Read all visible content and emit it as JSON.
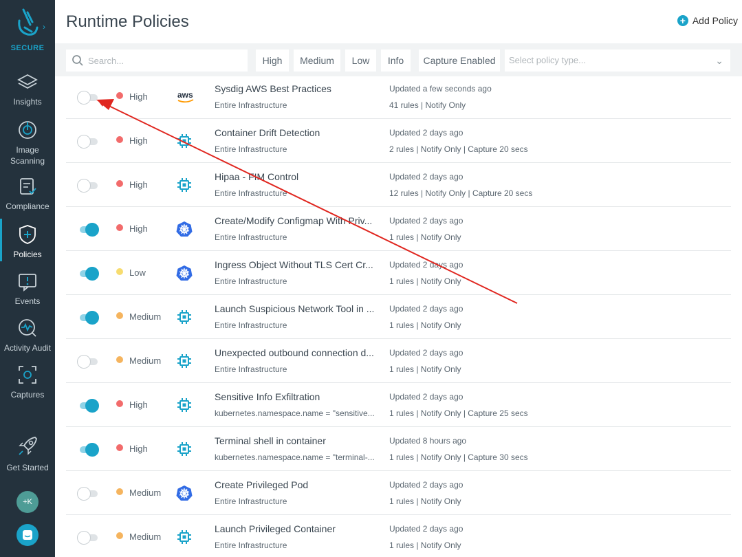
{
  "sidebar": {
    "brand": "SECURE",
    "items": [
      {
        "label": "Insights",
        "icon": "layers-icon"
      },
      {
        "label": "Image Scanning",
        "icon": "scan-icon"
      },
      {
        "label": "Compliance",
        "icon": "clipboard-check-icon"
      },
      {
        "label": "Policies",
        "icon": "shield-plus-icon",
        "active": true
      },
      {
        "label": "Events",
        "icon": "alert-monitor-icon"
      },
      {
        "label": "Activity Audit",
        "icon": "pulse-icon"
      },
      {
        "label": "Captures",
        "icon": "capture-icon"
      }
    ],
    "get_started": "Get Started",
    "avatar": "+K"
  },
  "header": {
    "title": "Runtime Policies",
    "add_policy": "Add Policy"
  },
  "filters": {
    "search_placeholder": "Search...",
    "chips": [
      "High",
      "Medium",
      "Low",
      "Info",
      "Capture Enabled"
    ],
    "type_placeholder": "Select policy type..."
  },
  "colors": {
    "accent": "#1aa3c9",
    "high": "#f26b6b",
    "medium": "#f5b45e",
    "low": "#f7dc6f",
    "sidebar": "#24323d"
  },
  "policies": [
    {
      "enabled": false,
      "severity": "High",
      "source": "aws",
      "name": "Sysdig AWS Best Practices",
      "scope": "Entire Infrastructure",
      "updated": "Updated a few seconds ago",
      "meta": "41 rules | Notify Only"
    },
    {
      "enabled": false,
      "severity": "High",
      "source": "falco",
      "name": "Container Drift Detection",
      "scope": "Entire Infrastructure",
      "updated": "Updated 2 days ago",
      "meta": "2 rules | Notify Only | Capture 20 secs"
    },
    {
      "enabled": false,
      "severity": "High",
      "source": "falco",
      "name": "Hipaa - FIM Control",
      "scope": "Entire Infrastructure",
      "updated": "Updated 2 days ago",
      "meta": "12 rules | Notify Only | Capture 20 secs"
    },
    {
      "enabled": true,
      "severity": "High",
      "source": "k8s",
      "name": "Create/Modify Configmap With Priv...",
      "scope": "Entire Infrastructure",
      "updated": "Updated 2 days ago",
      "meta": "1 rules | Notify Only"
    },
    {
      "enabled": true,
      "severity": "Low",
      "source": "k8s",
      "name": "Ingress Object Without TLS Cert Cr...",
      "scope": "Entire Infrastructure",
      "updated": "Updated 2 days ago",
      "meta": "1 rules | Notify Only"
    },
    {
      "enabled": true,
      "severity": "Medium",
      "source": "falco",
      "name": "Launch Suspicious Network Tool in ...",
      "scope": "Entire Infrastructure",
      "updated": "Updated 2 days ago",
      "meta": "1 rules | Notify Only"
    },
    {
      "enabled": false,
      "severity": "Medium",
      "source": "falco",
      "name": "Unexpected outbound connection d...",
      "scope": "Entire Infrastructure",
      "updated": "Updated 2 days ago",
      "meta": "1 rules | Notify Only"
    },
    {
      "enabled": true,
      "severity": "High",
      "source": "falco",
      "name": "Sensitive Info Exfiltration",
      "scope": "kubernetes.namespace.name = \"sensitive...",
      "updated": "Updated 2 days ago",
      "meta": "1 rules | Notify Only | Capture 25 secs"
    },
    {
      "enabled": true,
      "severity": "High",
      "source": "falco",
      "name": "Terminal shell in container",
      "scope": "kubernetes.namespace.name = \"terminal-...",
      "updated": "Updated 8 hours ago",
      "meta": "1 rules | Notify Only | Capture 30 secs"
    },
    {
      "enabled": false,
      "severity": "Medium",
      "source": "k8s",
      "name": "Create Privileged Pod",
      "scope": "Entire Infrastructure",
      "updated": "Updated 2 days ago",
      "meta": "1 rules | Notify Only"
    },
    {
      "enabled": false,
      "severity": "Medium",
      "source": "falco",
      "name": "Launch Privileged Container",
      "scope": "Entire Infrastructure",
      "updated": "Updated 2 days ago",
      "meta": "1 rules | Notify Only"
    }
  ]
}
